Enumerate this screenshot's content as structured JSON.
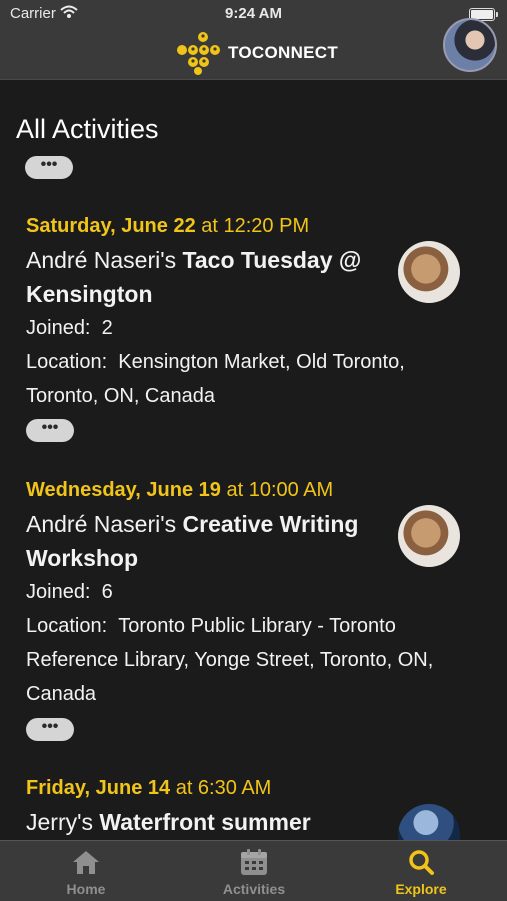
{
  "status_bar": {
    "carrier": "Carrier",
    "time": "9:24 AM"
  },
  "header": {
    "app_name": "TOCONNECT",
    "brand_color": "#f0c419"
  },
  "page": {
    "title": "All Activities",
    "more_label": "•••"
  },
  "activities": [
    {
      "day": "Saturday, June 22",
      "time": " at 12:20 PM",
      "host": "André Naseri's ",
      "title": "Taco Tuesday @ Kensington",
      "joined_label": "Joined:",
      "joined": "2",
      "location_label": "Location:",
      "location": "Kensington Market, Old Toronto, Toronto, ON, Canada",
      "more_label": "•••"
    },
    {
      "day": "Wednesday, June 19",
      "time": " at 10:00 AM",
      "host": "André Naseri's ",
      "title": "Creative Writing Workshop",
      "joined_label": "Joined:",
      "joined": "6",
      "location_label": "Location:",
      "location": "Toronto Public Library - Toronto Reference Library, Yonge Street, Toronto, ON, Canada",
      "more_label": "•••"
    },
    {
      "day": "Friday, June 14",
      "time": " at 6:30 AM",
      "host": "Jerry's ",
      "title": "Waterfront summer"
    }
  ],
  "tabs": [
    {
      "label": "Home",
      "icon": "home-icon"
    },
    {
      "label": "Activities",
      "icon": "calendar-icon"
    },
    {
      "label": "Explore",
      "icon": "search-icon",
      "active": true
    }
  ]
}
